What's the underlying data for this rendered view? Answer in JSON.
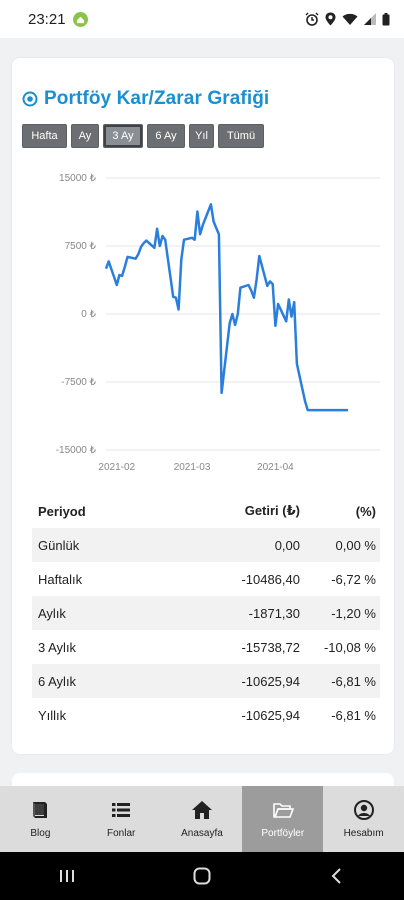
{
  "status_bar": {
    "time": "23:21"
  },
  "card": {
    "title": "Portföy Kar/Zarar Grafiği",
    "tabs": [
      {
        "label": "Hafta",
        "active": false
      },
      {
        "label": "Ay",
        "active": false
      },
      {
        "label": "3 Ay",
        "active": true
      },
      {
        "label": "6 Ay",
        "active": false
      },
      {
        "label": "Yıl",
        "active": false
      },
      {
        "label": "Tümü",
        "active": false
      }
    ]
  },
  "chart_data": {
    "type": "line",
    "title": "",
    "xlabel": "",
    "ylabel": "",
    "ylim": [
      -15000,
      15000
    ],
    "y_ticks": [
      "15000 ₺",
      "7500 ₺",
      "0 ₺",
      "-7500 ₺",
      "-15000 ₺"
    ],
    "x_tick_labels": [
      "2021-02",
      "2021-03",
      "2021-04"
    ],
    "grid": true,
    "color": "#2a7fdc",
    "series": [
      {
        "x": [
          "2021-01-28",
          "2021-01-29",
          "2021-02-01",
          "2021-02-02",
          "2021-02-03",
          "2021-02-04",
          "2021-02-05",
          "2021-02-08",
          "2021-02-09",
          "2021-02-10",
          "2021-02-11",
          "2021-02-12",
          "2021-02-15",
          "2021-02-16",
          "2021-02-17",
          "2021-02-18",
          "2021-02-19",
          "2021-02-22",
          "2021-02-23",
          "2021-02-24",
          "2021-02-25",
          "2021-02-26",
          "2021-03-01",
          "2021-03-02",
          "2021-03-03",
          "2021-03-04",
          "2021-03-05",
          "2021-03-08",
          "2021-03-09",
          "2021-03-10",
          "2021-03-11",
          "2021-03-12",
          "2021-03-15",
          "2021-03-16",
          "2021-03-17",
          "2021-03-18",
          "2021-03-19",
          "2021-03-22",
          "2021-03-23",
          "2021-03-24",
          "2021-03-25",
          "2021-03-26",
          "2021-03-29",
          "2021-03-30",
          "2021-03-31",
          "2021-04-01",
          "2021-04-02",
          "2021-04-05",
          "2021-04-06",
          "2021-04-07",
          "2021-04-08",
          "2021-04-09",
          "2021-04-12",
          "2021-04-13",
          "2021-04-14",
          "2021-04-15",
          "2021-04-16",
          "2021-04-19",
          "2021-04-20",
          "2021-04-21",
          "2021-04-22",
          "2021-04-23",
          "2021-04-26",
          "2021-04-27",
          "2021-04-28"
        ],
        "values": [
          5000,
          5800,
          3200,
          4300,
          4200,
          5200,
          6300,
          6100,
          6600,
          7400,
          7800,
          8100,
          7300,
          9400,
          7500,
          8600,
          8200,
          1900,
          1800,
          500,
          6000,
          8200,
          8400,
          8200,
          11300,
          8800,
          9800,
          12100,
          10200,
          9500,
          8800,
          -8700,
          -1000,
          0,
          -1200,
          0,
          2900,
          3200,
          2600,
          1800,
          3800,
          6400,
          3100,
          3600,
          3300,
          -1300,
          1100,
          -800,
          1600,
          -300,
          1300,
          -5500,
          -9600,
          -10600,
          -10600,
          -10600,
          -10600,
          -10600,
          -10600,
          -10600,
          -10600,
          -10600,
          -10600,
          -10600,
          -10600
        ]
      }
    ]
  },
  "period_table": {
    "headers": [
      "Periyod",
      "Getiri (₺)",
      "(%)"
    ],
    "rows": [
      {
        "period": "Günlük",
        "return": "0,00",
        "pct": "0,00 %"
      },
      {
        "period": "Haftalık",
        "return": "-10486,40",
        "pct": "-6,72 %"
      },
      {
        "period": "Aylık",
        "return": "-1871,30",
        "pct": "-1,20 %"
      },
      {
        "period": "3 Aylık",
        "return": "-15738,72",
        "pct": "-10,08 %"
      },
      {
        "period": "6 Aylık",
        "return": "-10625,94",
        "pct": "-6,81 %"
      },
      {
        "period": "Yıllık",
        "return": "-10625,94",
        "pct": "-6,81 %"
      }
    ]
  },
  "bottom_nav": [
    {
      "label": "Blog",
      "icon": "book-icon",
      "active": false
    },
    {
      "label": "Fonlar",
      "icon": "list-icon",
      "active": false
    },
    {
      "label": "Anasayfa",
      "icon": "home-icon",
      "active": false
    },
    {
      "label": "Portföyler",
      "icon": "folder-open-icon",
      "active": true
    },
    {
      "label": "Hesabım",
      "icon": "account-icon",
      "active": false
    }
  ]
}
